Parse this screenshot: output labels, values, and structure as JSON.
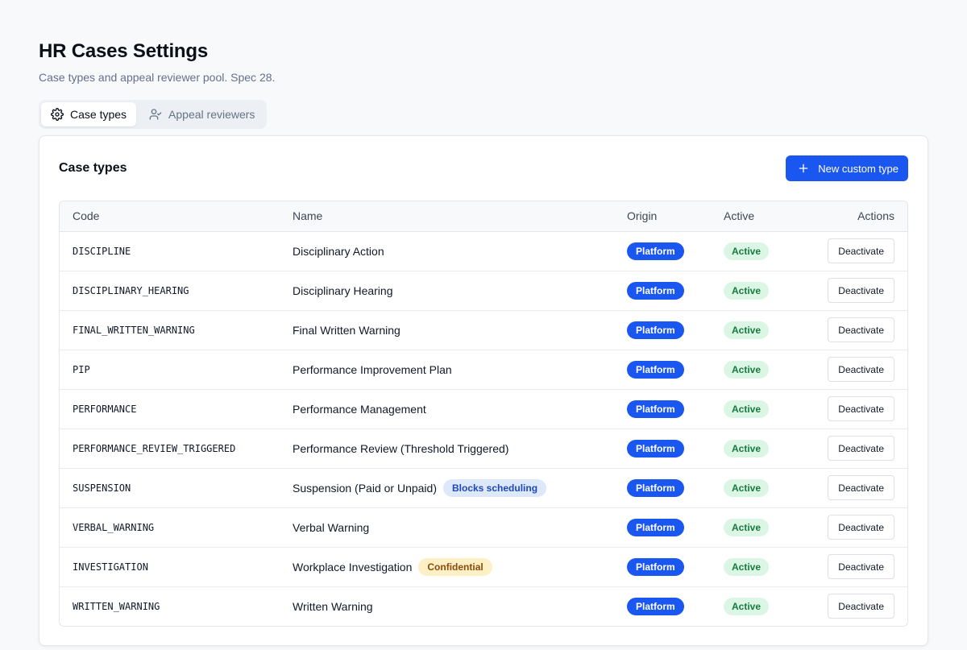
{
  "page": {
    "title": "HR Cases Settings",
    "subtitle": "Case types and appeal reviewer pool. Spec 28."
  },
  "tabs": [
    {
      "label": "Case types",
      "icon": "gear-icon",
      "active": true
    },
    {
      "label": "Appeal reviewers",
      "icon": "user-check-icon",
      "active": false
    }
  ],
  "card": {
    "title": "Case types",
    "new_button_label": "New custom type"
  },
  "table": {
    "columns": [
      "Code",
      "Name",
      "Origin",
      "Active",
      "Actions"
    ],
    "rows": [
      {
        "code": "DISCIPLINE",
        "name": "Disciplinary Action",
        "tag": "",
        "origin": "Platform",
        "active": "Active",
        "action": "Deactivate"
      },
      {
        "code": "DISCIPLINARY_HEARING",
        "name": "Disciplinary Hearing",
        "tag": "",
        "origin": "Platform",
        "active": "Active",
        "action": "Deactivate"
      },
      {
        "code": "FINAL_WRITTEN_WARNING",
        "name": "Final Written Warning",
        "tag": "",
        "origin": "Platform",
        "active": "Active",
        "action": "Deactivate"
      },
      {
        "code": "PIP",
        "name": "Performance Improvement Plan",
        "tag": "",
        "origin": "Platform",
        "active": "Active",
        "action": "Deactivate"
      },
      {
        "code": "PERFORMANCE",
        "name": "Performance Management",
        "tag": "",
        "origin": "Platform",
        "active": "Active",
        "action": "Deactivate"
      },
      {
        "code": "PERFORMANCE_REVIEW_TRIGGERED",
        "name": "Performance Review (Threshold Triggered)",
        "tag": "",
        "origin": "Platform",
        "active": "Active",
        "action": "Deactivate"
      },
      {
        "code": "SUSPENSION",
        "name": "Suspension (Paid or Unpaid)",
        "tag": "Blocks scheduling",
        "origin": "Platform",
        "active": "Active",
        "action": "Deactivate"
      },
      {
        "code": "VERBAL_WARNING",
        "name": "Verbal Warning",
        "tag": "",
        "origin": "Platform",
        "active": "Active",
        "action": "Deactivate"
      },
      {
        "code": "INVESTIGATION",
        "name": "Workplace Investigation",
        "tag": "Confidential",
        "origin": "Platform",
        "active": "Active",
        "action": "Deactivate"
      },
      {
        "code": "WRITTEN_WARNING",
        "name": "Written Warning",
        "tag": "",
        "origin": "Platform",
        "active": "Active",
        "action": "Deactivate"
      }
    ]
  },
  "colors": {
    "accent": "#1a56f0",
    "active_badge_bg": "#dcf6e5",
    "active_badge_text": "#167a3f",
    "blocks_tag_bg": "#dde8fb",
    "confidential_tag_bg": "#fdf0c4"
  }
}
